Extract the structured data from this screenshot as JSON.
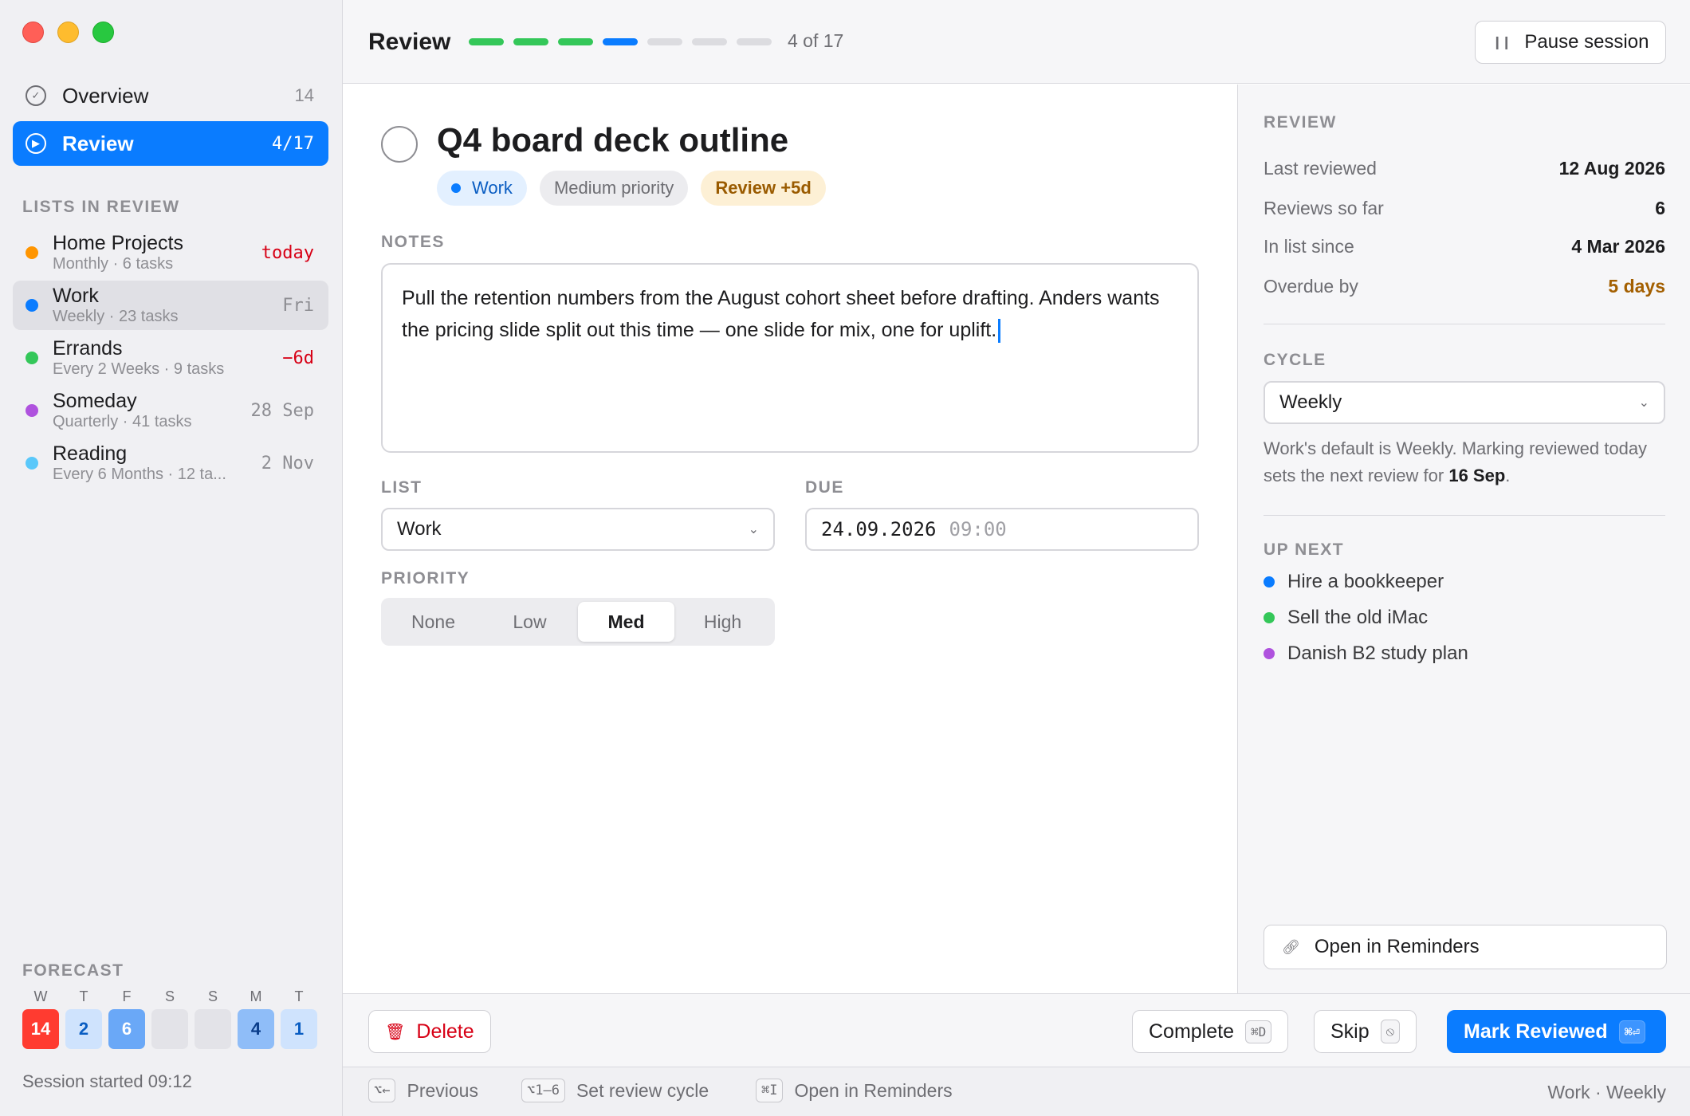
{
  "sidebar": {
    "nav": [
      {
        "label": "Overview",
        "count": "14",
        "icon": "checkmark-circle-icon"
      },
      {
        "label": "Review",
        "count": "4/17",
        "icon": "play-circle-icon"
      }
    ],
    "lists_title": "LISTS IN REVIEW",
    "lists": [
      {
        "name": "Home Projects",
        "meta": "Monthly · 6 tasks",
        "due": "today",
        "color": "#ff9500"
      },
      {
        "name": "Work",
        "meta": "Weekly · 23 tasks",
        "due": "Fri",
        "color": "#0a7cff"
      },
      {
        "name": "Errands",
        "meta": "Every 2 Weeks · 9 tasks",
        "due": "−6d",
        "color": "#34c759"
      },
      {
        "name": "Someday",
        "meta": "Quarterly · 41 tasks",
        "due": "28 Sep",
        "color": "#af52de"
      },
      {
        "name": "Reading",
        "meta": "Every 6 Months · 12 ta...",
        "due": "2 Nov",
        "color": "#5ac8fa"
      }
    ],
    "forecast_title": "FORECAST",
    "forecast": [
      {
        "day": "W",
        "count": "14",
        "bg": "#ff3b30",
        "fg": "#ffffff"
      },
      {
        "day": "T",
        "count": "2",
        "bg": "#cfe3fd",
        "fg": "#0a5dc2"
      },
      {
        "day": "F",
        "count": "6",
        "bg": "#6aa8f7",
        "fg": "#ffffff"
      },
      {
        "day": "S",
        "count": "",
        "bg": "#e3e3e8",
        "fg": "#1d1d1f"
      },
      {
        "day": "S",
        "count": "",
        "bg": "#e3e3e8",
        "fg": "#1d1d1f"
      },
      {
        "day": "M",
        "count": "4",
        "bg": "#8fbdf8",
        "fg": "#0a3d8a"
      },
      {
        "day": "T",
        "count": "1",
        "bg": "#cfe3fd",
        "fg": "#0a5dc2"
      }
    ],
    "session_started": "Session started 09:12"
  },
  "header": {
    "title": "Review",
    "progress": {
      "done": 3,
      "current": 4,
      "segments_shown": 7
    },
    "progress_text": "4 of 17",
    "pause_label": "Pause session"
  },
  "task": {
    "title": "Q4 board deck outline",
    "chips": {
      "list": "Work",
      "priority": "Medium priority",
      "review": "Review +5d"
    },
    "notes_label": "NOTES",
    "notes": "Pull the retention numbers from the August cohort sheet before drafting. Anders wants the pricing slide split out this time — one slide for mix, one for uplift.",
    "list_label": "LIST",
    "list_value": "Work",
    "due_label": "DUE",
    "due_date": "24.09.2026",
    "due_time": "09:00",
    "priority_label": "PRIORITY",
    "priority_options": [
      "None",
      "Low",
      "Med",
      "High"
    ],
    "priority_selected": "Med"
  },
  "inspector": {
    "review_title": "REVIEW",
    "rows": [
      {
        "k": "Last reviewed",
        "v": "12 Aug 2026"
      },
      {
        "k": "Reviews so far",
        "v": "6"
      },
      {
        "k": "In list since",
        "v": "4 Mar 2026"
      },
      {
        "k": "Overdue by",
        "v": "5 days"
      }
    ],
    "cycle_title": "CYCLE",
    "cycle_value": "Weekly",
    "cycle_note_pre": "Work's default is Weekly. Marking reviewed today sets the next review for ",
    "cycle_note_date": "16 Sep",
    "cycle_note_post": ".",
    "upnext_title": "UP NEXT",
    "upnext": [
      {
        "label": "Hire a bookkeeper",
        "color": "#0a7cff"
      },
      {
        "label": "Sell the old iMac",
        "color": "#34c759"
      },
      {
        "label": "Danish B2 study plan",
        "color": "#af52de"
      }
    ],
    "open_label": "Open in Reminders"
  },
  "actions": {
    "delete": "Delete",
    "complete": "Complete",
    "complete_kbd": "⌘D",
    "skip": "Skip",
    "skip_kbd": "⦸",
    "mark": "Mark Reviewed",
    "mark_kbd": "⌘⏎"
  },
  "shortcuts": [
    {
      "kbd": "⌥←",
      "label": "Previous"
    },
    {
      "kbd": "⌥1–6",
      "label": "Set review cycle"
    },
    {
      "kbd": "⌘I",
      "label": "Open in Reminders"
    }
  ],
  "context": "Work · Weekly"
}
